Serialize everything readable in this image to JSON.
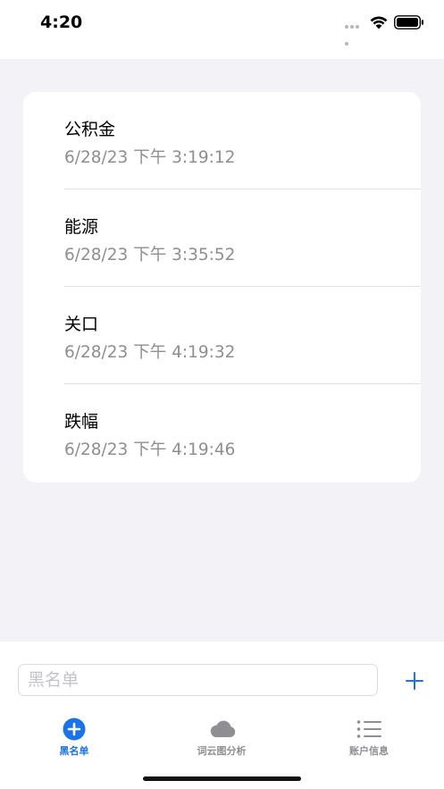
{
  "status_bar": {
    "time": "4:20"
  },
  "blacklist": {
    "items": [
      {
        "title": "公积金",
        "timestamp": "6/28/23 下午 3:19:12"
      },
      {
        "title": "能源",
        "timestamp": "6/28/23 下午 3:35:52"
      },
      {
        "title": "关口",
        "timestamp": "6/28/23 下午 4:19:32"
      },
      {
        "title": "跌幅",
        "timestamp": "6/28/23 下午 4:19:46"
      }
    ]
  },
  "input": {
    "placeholder": "黑名单",
    "value": ""
  },
  "tabs": [
    {
      "label": "黑名单",
      "icon": "plus-circle-icon",
      "active": true
    },
    {
      "label": "词云图分析",
      "icon": "cloud-icon",
      "active": false
    },
    {
      "label": "账户信息",
      "icon": "list-icon",
      "active": false
    }
  ],
  "colors": {
    "accent": "#1a73e8",
    "inactive": "#8e8e93",
    "background": "#f2f2f7",
    "secondary_text": "#8e8e93"
  }
}
